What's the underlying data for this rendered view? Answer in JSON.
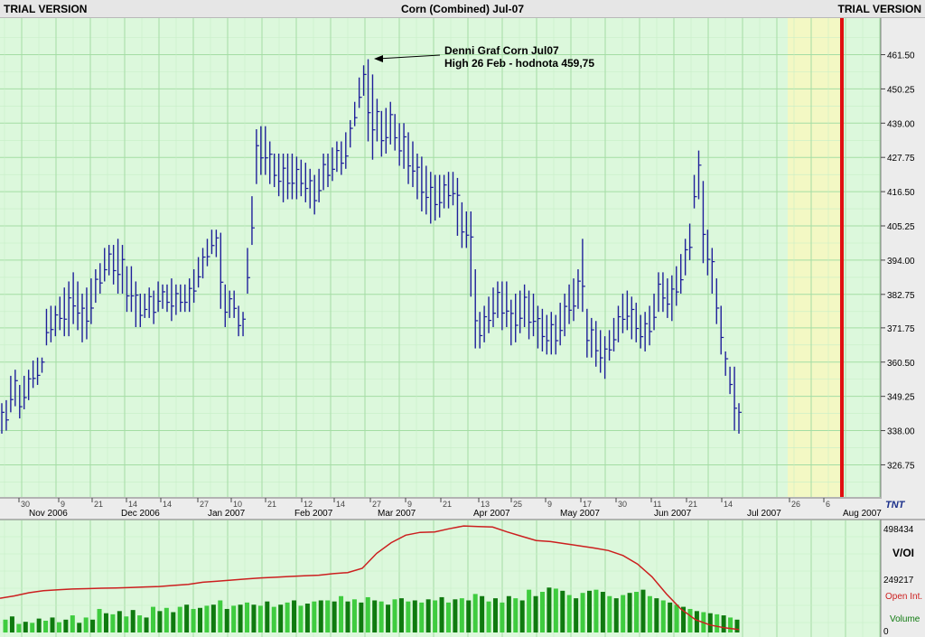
{
  "header": {
    "trial_left": "TRIAL VERSION",
    "title": "Corn (Combined) Jul-07",
    "trial_right": "TRIAL VERSION"
  },
  "annotation": {
    "line1": "Denni Graf Corn Jul07",
    "line2": "High 26 Feb - hodnota 459,75"
  },
  "lower_panel": {
    "title": "V/OI",
    "open_int_label": "Open Int.",
    "volume_label": "Volume",
    "y_ticks": [
      "498434",
      "249217",
      "0"
    ]
  },
  "logo_text": "TNT",
  "colors": {
    "background": "#dcf8dc",
    "grid_major": "#a4dda4",
    "grid_minor": "#c6eec6",
    "price_bars": "#1f1f9a",
    "open_interest": "#cc1f1f",
    "volume_dark": "#0f7a0f",
    "volume_light": "#3fcc3f",
    "expiry_marker": "#e01010",
    "future_zone": "#f3f8c4"
  },
  "chart_data": [
    {
      "type": "ohlc",
      "title": "Corn (Combined) Jul-07",
      "ylabel": "",
      "ylim": [
        320,
        470
      ],
      "y_ticks": [
        "461.50",
        "450.25",
        "439.00",
        "427.75",
        "416.50",
        "405.25",
        "394.00",
        "382.75",
        "371.75",
        "360.50",
        "349.25",
        "338.00",
        "326.75"
      ],
      "x_day_ticks": [
        "30",
        "9",
        "21",
        "14",
        "14",
        "27",
        "10",
        "21",
        "12",
        "14",
        "27",
        "9",
        "21",
        "13",
        "25",
        "9",
        "17",
        "30",
        "11",
        "21",
        "14",
        "26",
        "6"
      ],
      "x_month_labels": [
        "Nov 2006",
        "Dec 2006",
        "Jan 2007",
        "Feb 2007",
        "Mar 2007",
        "Apr 2007",
        "May 2007",
        "Jun 2007",
        "Jul 2007",
        "Aug 2007"
      ],
      "grid": true,
      "series": {
        "high": [
          347,
          348,
          356,
          358,
          353,
          356,
          358,
          361,
          362,
          362,
          378,
          379,
          379,
          382,
          385,
          387,
          390,
          387,
          383,
          385,
          388,
          391,
          393,
          398,
          399,
          399,
          401,
          399,
          392,
          392,
          387,
          383,
          383,
          385,
          384,
          387,
          386,
          386,
          388,
          386,
          386,
          386,
          388,
          391,
          395,
          398,
          401,
          404,
          404,
          403,
          386,
          384,
          384,
          379,
          377,
          398,
          415,
          437,
          438,
          438,
          433,
          429,
          429,
          429,
          429,
          429,
          428,
          427,
          426,
          424,
          422,
          424,
          429,
          429,
          431,
          433,
          433,
          436,
          440,
          446,
          454,
          458,
          460,
          455,
          447,
          443,
          444,
          446,
          442,
          439,
          439,
          436,
          433,
          429,
          428,
          425,
          423,
          422,
          422,
          422,
          423,
          423,
          421,
          413,
          410,
          410,
          391,
          377,
          379,
          382,
          385,
          387,
          387,
          387,
          381,
          383,
          384,
          386,
          384,
          383,
          379,
          378,
          376,
          377,
          376,
          380,
          383,
          386,
          388,
          391,
          401,
          378,
          375,
          374,
          371,
          369,
          371,
          375,
          379,
          383,
          384,
          382,
          380,
          376,
          377,
          379,
          383,
          390,
          390,
          388,
          389,
          392,
          396,
          401,
          406,
          422,
          430,
          420,
          404,
          398,
          388,
          379,
          364,
          359,
          359,
          347
        ],
        "low": [
          337,
          338,
          344,
          346,
          342,
          345,
          348,
          352,
          353,
          357,
          366,
          367,
          369,
          371,
          369,
          369,
          373,
          371,
          367,
          368,
          373,
          380,
          383,
          387,
          389,
          386,
          383,
          383,
          377,
          377,
          372,
          372,
          375,
          375,
          373,
          377,
          378,
          377,
          374,
          376,
          377,
          377,
          377,
          380,
          385,
          388,
          392,
          396,
          395,
          378,
          372,
          375,
          375,
          369,
          369,
          383,
          399,
          419,
          422,
          422,
          419,
          418,
          415,
          413,
          414,
          414,
          414,
          415,
          413,
          411,
          409,
          413,
          417,
          418,
          420,
          423,
          422,
          424,
          431,
          438,
          444,
          448,
          433,
          427,
          433,
          428,
          429,
          432,
          430,
          425,
          424,
          419,
          418,
          414,
          410,
          409,
          406,
          407,
          408,
          411,
          411,
          412,
          402,
          398,
          398,
          382,
          365,
          365,
          367,
          370,
          372,
          375,
          371,
          372,
          366,
          367,
          370,
          372,
          368,
          369,
          365,
          364,
          363,
          363,
          363,
          366,
          369,
          373,
          374,
          378,
          377,
          362,
          362,
          359,
          357,
          355,
          361,
          364,
          367,
          370,
          371,
          368,
          367,
          365,
          364,
          366,
          371,
          377,
          377,
          375,
          374,
          379,
          383,
          389,
          394,
          411,
          414,
          393,
          389,
          383,
          373,
          363,
          356,
          350,
          338,
          337
        ]
      }
    },
    {
      "type": "line",
      "title": "V/OI",
      "ylim": [
        0,
        498434
      ],
      "series": [
        {
          "name": "Open Int.",
          "values": [
            160000,
            171000,
            186000,
            195000,
            200000,
            203000,
            205000,
            207000,
            208000,
            210000,
            213000,
            215000,
            220000,
            225000,
            235000,
            240000,
            245000,
            250000,
            255000,
            258000,
            262000,
            265000,
            268000,
            275000,
            280000,
            300000,
            370000,
            420000,
            455000,
            468000,
            470000,
            485000,
            498000,
            495000,
            493000,
            470000,
            450000,
            430000,
            425000,
            415000,
            405000,
            395000,
            383000,
            360000,
            320000,
            260000,
            180000,
            110000,
            60000,
            35000,
            22000,
            14000
          ]
        },
        {
          "name": "Volume",
          "values": [
            60000,
            75000,
            40000,
            50000,
            45000,
            65000,
            55000,
            70000,
            48000,
            60000,
            80000,
            45000,
            70000,
            60000,
            110000,
            90000,
            85000,
            100000,
            75000,
            105000,
            80000,
            70000,
            120000,
            100000,
            115000,
            95000,
            120000,
            130000,
            110000,
            115000,
            125000,
            130000,
            150000,
            110000,
            125000,
            130000,
            140000,
            130000,
            125000,
            145000,
            120000,
            130000,
            140000,
            150000,
            125000,
            135000,
            145000,
            150000,
            150000,
            145000,
            170000,
            145000,
            155000,
            140000,
            165000,
            150000,
            145000,
            130000,
            155000,
            160000,
            145000,
            150000,
            140000,
            155000,
            150000,
            165000,
            140000,
            155000,
            160000,
            150000,
            180000,
            170000,
            145000,
            160000,
            140000,
            170000,
            160000,
            150000,
            200000,
            170000,
            190000,
            210000,
            205000,
            195000,
            175000,
            160000,
            185000,
            195000,
            200000,
            190000,
            170000,
            160000,
            175000,
            185000,
            190000,
            200000,
            170000,
            160000,
            150000,
            140000,
            130000,
            120000,
            110000,
            100000,
            95000,
            90000,
            85000,
            80000,
            70000,
            60000
          ]
        }
      ]
    }
  ]
}
